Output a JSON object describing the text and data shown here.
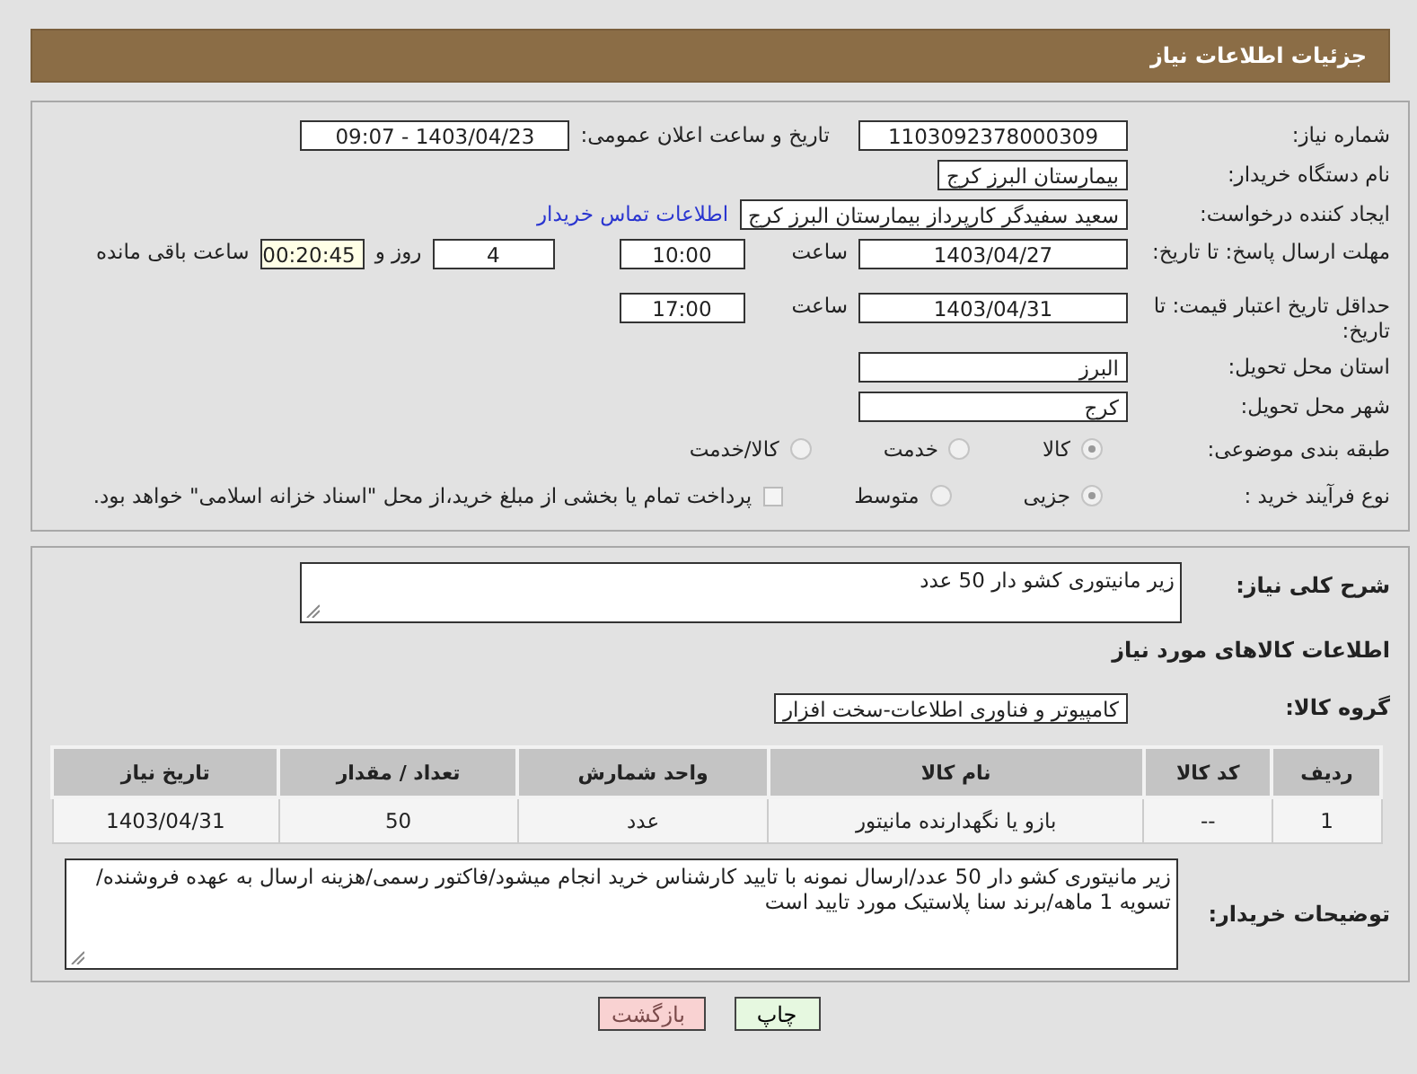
{
  "header": {
    "title": "جزئیات اطلاعات نیاز"
  },
  "need_number": {
    "label": "شماره نیاز:",
    "value": "1103092378000309"
  },
  "announce": {
    "label": "تاریخ و ساعت اعلان عمومی:",
    "value": "1403/04/23 - 09:07"
  },
  "buyer_org": {
    "label": "نام دستگاه خریدار:",
    "value": "بیمارستان البرز کرج"
  },
  "creator": {
    "label": "ایجاد کننده درخواست:",
    "value": "سعید سفیدگر کارپرداز بیمارستان البرز کرج",
    "link": "اطلاعات تماس خریدار"
  },
  "reply_deadline": {
    "label": "مهلت ارسال پاسخ: تا تاریخ:",
    "date": "1403/04/27",
    "time_label": "ساعت",
    "time": "10:00",
    "days": "4",
    "days_label": "روز و",
    "remaining": "00:20:45",
    "remaining_label": "ساعت باقی مانده"
  },
  "price_validity": {
    "label": "حداقل تاریخ اعتبار قیمت: تا تاریخ:",
    "date": "1403/04/31",
    "time_label": "ساعت",
    "time": "17:00"
  },
  "province": {
    "label": "استان محل تحویل:",
    "value": "البرز"
  },
  "city": {
    "label": "شهر محل تحویل:",
    "value": "کرج"
  },
  "category": {
    "label": "طبقه بندی موضوعی:",
    "options": [
      {
        "label": "کالا",
        "selected": true
      },
      {
        "label": "خدمت",
        "selected": false
      },
      {
        "label": "کالا/خدمت",
        "selected": false
      }
    ]
  },
  "process": {
    "label": "نوع فرآیند خرید :",
    "options": [
      {
        "label": "جزیی",
        "selected": true
      },
      {
        "label": "متوسط",
        "selected": false
      }
    ],
    "payment": {
      "label": "پرداخت تمام یا بخشی از مبلغ خرید،از محل \"اسناد خزانه اسلامی\" خواهد بود.",
      "checked": false
    }
  },
  "summary": {
    "label": "شرح کلی نیاز:",
    "value": "زیر مانیتوری کشو دار 50 عدد"
  },
  "goods_heading": "اطلاعات کالاهای مورد نیاز",
  "goods_group": {
    "label": "گروه کالا:",
    "value": "کامپیوتر و فناوری اطلاعات-سخت افزار"
  },
  "table": {
    "columns": [
      "ردیف",
      "کد کالا",
      "نام کالا",
      "واحد شمارش",
      "تعداد / مقدار",
      "تاریخ نیاز"
    ],
    "rows": [
      [
        "1",
        "--",
        "بازو یا نگهدارنده مانیتور",
        "عدد",
        "50",
        "1403/04/31"
      ]
    ]
  },
  "buyer_notes": {
    "label": "توضیحات خریدار:",
    "value": "زیر مانیتوری کشو دار 50 عدد/ارسال نمونه با تایید کارشناس خرید انجام میشود/فاکتور رسمی/هزینه ارسال به عهده فروشنده/تسویه 1 ماهه/برند سنا پلاستیک مورد تایید است"
  },
  "buttons": [
    {
      "label": "چاپ",
      "kind": "print"
    },
    {
      "label": "بازگشت",
      "kind": "back"
    }
  ]
}
